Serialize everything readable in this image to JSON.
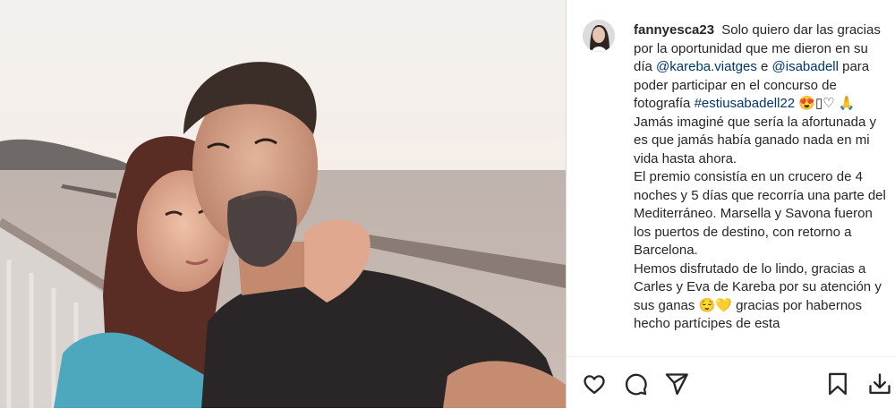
{
  "post": {
    "username": "fannyesca23",
    "caption": {
      "intro": "Solo quiero dar las gracias por la oportunidad que me dieron en su día",
      "mention_1": "@kareba.viatges",
      "connector_1": "e",
      "mention_2": "@isabadell",
      "text_2": "para poder participar en el concurso de fotografía",
      "hashtag": "#estiusabadell22",
      "emojis_1": "😍▯♡ 🙏",
      "para_1": "Jamás imaginé que sería la afortunada y es que jamás había ganado nada en mi vida hasta ahora.",
      "para_2": "El premio consistía en un crucero de 4 noches y 5 días que recorría una parte del Mediterráneo. Marsella y Savona fueron los puertos de destino, con retorno a Barcelona.",
      "para_3_a": "Hemos disfrutado de lo lindo, gracias a Carles y Eva de Kareba por su atención y sus ganas",
      "emojis_2": "😌💛",
      "para_3_b": "gracias por habernos hecho partícipes de esta"
    }
  },
  "actions": {
    "like_icon": "heart-icon",
    "comment_icon": "comment-icon",
    "share_icon": "send-icon",
    "save_icon": "bookmark-icon",
    "download_icon": "download-icon"
  },
  "colors": {
    "text": "#262626",
    "link": "#00376b",
    "divider": "#dbdbdb"
  }
}
